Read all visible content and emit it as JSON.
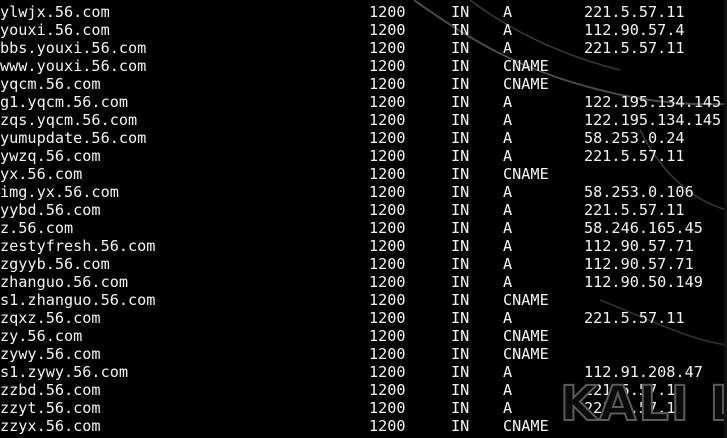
{
  "records": [
    {
      "host": "ylwjx.56.com",
      "ttl": "1200",
      "class": "IN",
      "type": "A",
      "addr": "221.5.57.11"
    },
    {
      "host": "youxi.56.com",
      "ttl": "1200",
      "class": "IN",
      "type": "A",
      "addr": "112.90.57.4"
    },
    {
      "host": "bbs.youxi.56.com",
      "ttl": "1200",
      "class": "IN",
      "type": "A",
      "addr": "221.5.57.11"
    },
    {
      "host": "www.youxi.56.com",
      "ttl": "1200",
      "class": "IN",
      "type": "CNAME",
      "addr": ""
    },
    {
      "host": "yqcm.56.com",
      "ttl": "1200",
      "class": "IN",
      "type": "CNAME",
      "addr": ""
    },
    {
      "host": "g1.yqcm.56.com",
      "ttl": "1200",
      "class": "IN",
      "type": "A",
      "addr": "122.195.134.145"
    },
    {
      "host": "zqs.yqcm.56.com",
      "ttl": "1200",
      "class": "IN",
      "type": "A",
      "addr": "122.195.134.145"
    },
    {
      "host": "yumupdate.56.com",
      "ttl": "1200",
      "class": "IN",
      "type": "A",
      "addr": "58.253.0.24"
    },
    {
      "host": "ywzq.56.com",
      "ttl": "1200",
      "class": "IN",
      "type": "A",
      "addr": "221.5.57.11"
    },
    {
      "host": "yx.56.com",
      "ttl": "1200",
      "class": "IN",
      "type": "CNAME",
      "addr": ""
    },
    {
      "host": "img.yx.56.com",
      "ttl": "1200",
      "class": "IN",
      "type": "A",
      "addr": "58.253.0.106"
    },
    {
      "host": "yybd.56.com",
      "ttl": "1200",
      "class": "IN",
      "type": "A",
      "addr": "221.5.57.11"
    },
    {
      "host": "z.56.com",
      "ttl": "1200",
      "class": "IN",
      "type": "A",
      "addr": "58.246.165.45"
    },
    {
      "host": "zestyfresh.56.com",
      "ttl": "1200",
      "class": "IN",
      "type": "A",
      "addr": "112.90.57.71"
    },
    {
      "host": "zgyyb.56.com",
      "ttl": "1200",
      "class": "IN",
      "type": "A",
      "addr": "112.90.57.71"
    },
    {
      "host": "zhanguo.56.com",
      "ttl": "1200",
      "class": "IN",
      "type": "A",
      "addr": "112.90.50.149"
    },
    {
      "host": "s1.zhanguo.56.com",
      "ttl": "1200",
      "class": "IN",
      "type": "CNAME",
      "addr": ""
    },
    {
      "host": "zqxz.56.com",
      "ttl": "1200",
      "class": "IN",
      "type": "A",
      "addr": "221.5.57.11"
    },
    {
      "host": "zy.56.com",
      "ttl": "1200",
      "class": "IN",
      "type": "CNAME",
      "addr": ""
    },
    {
      "host": "zywy.56.com",
      "ttl": "1200",
      "class": "IN",
      "type": "CNAME",
      "addr": ""
    },
    {
      "host": "s1.zywy.56.com",
      "ttl": "1200",
      "class": "IN",
      "type": "A",
      "addr": "112.91.208.47"
    },
    {
      "host": "zzbd.56.com",
      "ttl": "1200",
      "class": "IN",
      "type": "A",
      "addr": "221.5.57.11"
    },
    {
      "host": "zzyt.56.com",
      "ttl": "1200",
      "class": "IN",
      "type": "A",
      "addr": "221.5.57.11"
    },
    {
      "host": "zzyx.56.com",
      "ttl": "1200",
      "class": "IN",
      "type": "CNAME",
      "addr": ""
    }
  ],
  "watermark": "KALI L",
  "colors": {
    "background": "#000000",
    "text": "#f4f4f4",
    "dragon_line": "#4a4a4a"
  }
}
